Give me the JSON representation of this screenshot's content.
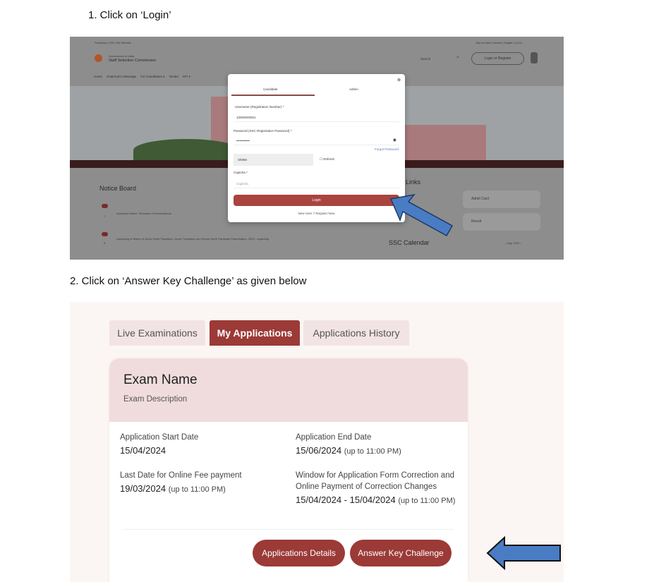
{
  "steps": [
    {
      "text": "1.  Click on ‘Login’"
    },
    {
      "text": "2.  Click on ‘Answer Key Challenge’ as given  below"
    }
  ],
  "login_screen": {
    "top_links": "Feedback | SSC Old Website",
    "top_right": "Skip to Main Content | English | A A A",
    "org_line1": "Government of India",
    "org_line2": "Staff Selection Commission",
    "nav": [
      "Home",
      "Chairman's Message",
      "For Candidates ▾",
      "Tender",
      "RTI ▾"
    ],
    "search_placeholder": "Search",
    "login_register": "Login or Register",
    "notice_board": "Notice Board",
    "notices": [
      {
        "text": "Important Notice: Schedule of Examinations",
        "day": "7",
        "year": "2024"
      },
      {
        "text": "Uploading of Marks of Junior Hindi Translator, Junior Translator and Senior Hindi Translator Examination, 2023 - regarding",
        "day": "6",
        "year": "2024"
      }
    ],
    "quick_links_title": "Links",
    "quick_links": [
      "Admit Card",
      "Result"
    ],
    "calendar_title": "SSC Calendar",
    "calendar_month": "‹ July, 2024 ›",
    "modal": {
      "tabs": [
        "Candidate",
        "Admin"
      ],
      "username_label": "Username (Registration Number) *",
      "username_value": "10000000001",
      "password_label": "Password (SSC Registration Password) *",
      "password_value": "••••••••••••",
      "forgot": "Forgot Password",
      "captcha_image_text": "Sh0t6r",
      "refresh": "Refresh",
      "captcha_label": "Captcha *",
      "captcha_placeholder": "Captcha",
      "login_button": "Login",
      "new_user": "New User ?",
      "register_new": "Register New"
    },
    "arrow_color": "#4a7cc4"
  },
  "applications_screen": {
    "tabs": [
      {
        "label": "Live Examinations",
        "active": false
      },
      {
        "label": "My Applications",
        "active": true
      },
      {
        "label": "Applications History",
        "active": false
      }
    ],
    "exam_name": "Exam Name",
    "exam_description": "Exam Description",
    "fields": {
      "start_label": "Application Start Date",
      "start_value": "15/04/2024",
      "end_label": "Application End Date",
      "end_value": "15/06/2024",
      "end_note": "(up to 11:00 PM)",
      "fee_label": "Last Date for Online Fee payment",
      "fee_value": "19/03/2024",
      "fee_note": "(up to 11:00 PM)",
      "window_label_1": "Window for Application Form Correction and",
      "window_label_2": "Online Payment of Correction Changes",
      "window_value": "15/04/2024 - 15/04/2024",
      "window_note": "(up to 11:00 PM)"
    },
    "buttons": {
      "details": "Applications Details",
      "challenge": "Answer Key Challenge"
    },
    "accent": "#9b3a37",
    "arrow_color": "#4a7cc4"
  }
}
